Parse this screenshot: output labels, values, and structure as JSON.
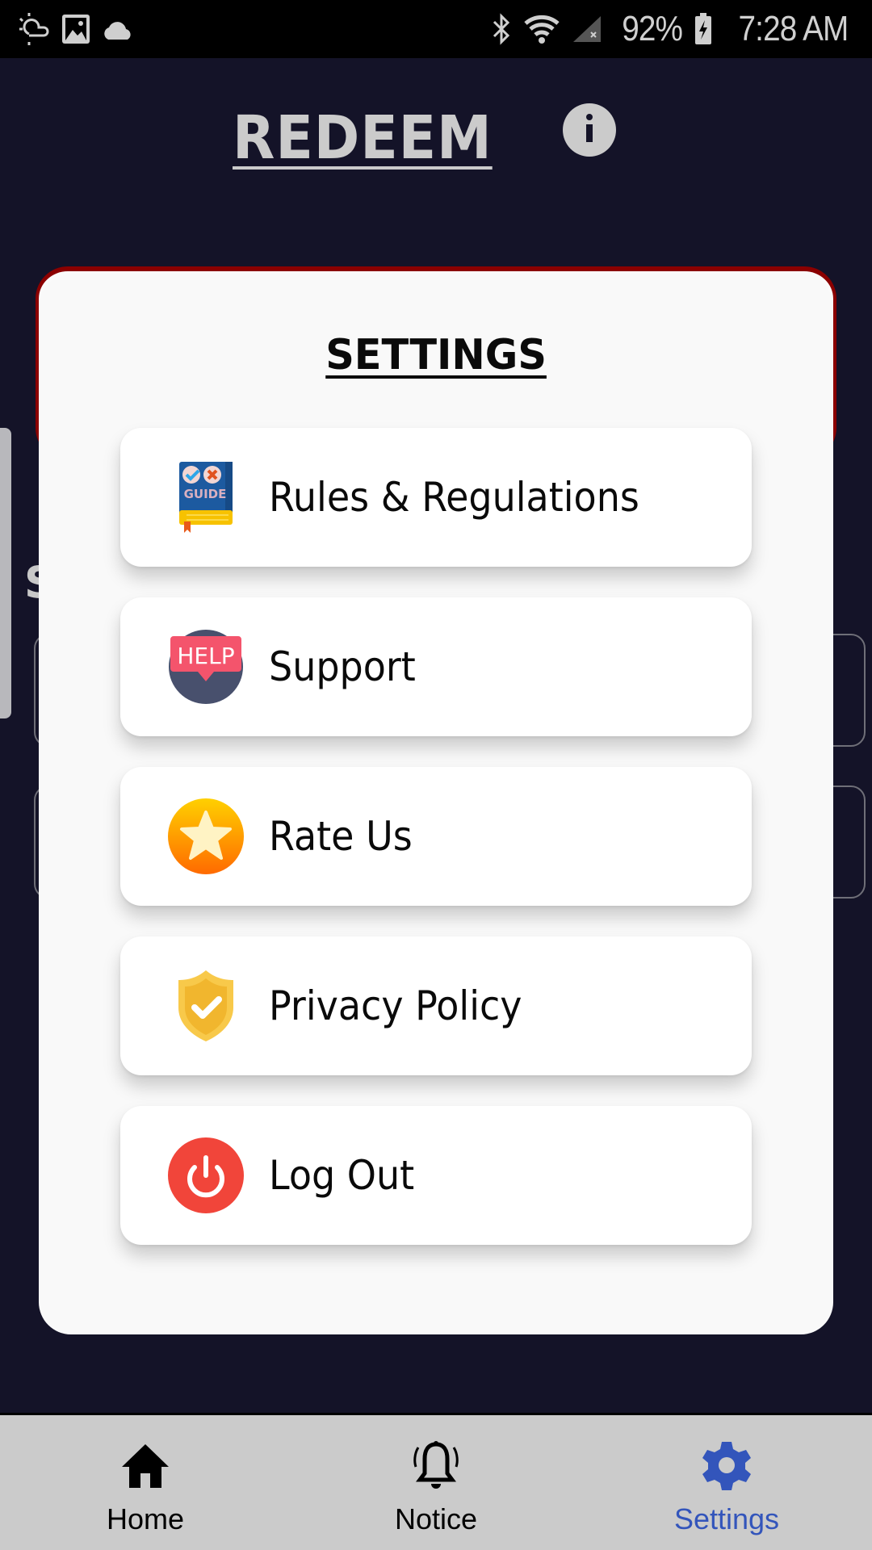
{
  "status_bar": {
    "battery": "92%",
    "time": "7:28 AM",
    "left_icons": [
      "weather-icon",
      "image-icon",
      "cloud-icon"
    ],
    "right_icons": [
      "bluetooth-icon",
      "wifi-icon",
      "no-signal-icon",
      "battery-charging-icon"
    ]
  },
  "page": {
    "title": "REDEEM",
    "info_icon": "info-icon",
    "partial_heading_letter": "S"
  },
  "dialog": {
    "title": "SETTINGS",
    "items": [
      {
        "label": "Rules & Regulations",
        "icon": "guide-book-icon"
      },
      {
        "label": "Support",
        "icon": "help-icon"
      },
      {
        "label": "Rate Us",
        "icon": "star-icon"
      },
      {
        "label": "Privacy Policy",
        "icon": "shield-check-icon"
      },
      {
        "label": "Log Out",
        "icon": "power-icon"
      }
    ]
  },
  "bottom_nav": {
    "items": [
      {
        "label": "Home",
        "icon": "home-icon",
        "active": false
      },
      {
        "label": "Notice",
        "icon": "bell-icon",
        "active": false
      },
      {
        "label": "Settings",
        "icon": "gear-icon",
        "active": true
      }
    ]
  },
  "colors": {
    "background": "#141328",
    "accent": "#3355bb",
    "dialog_bg": "#f9f9f9",
    "red_border": "#8b0000"
  }
}
